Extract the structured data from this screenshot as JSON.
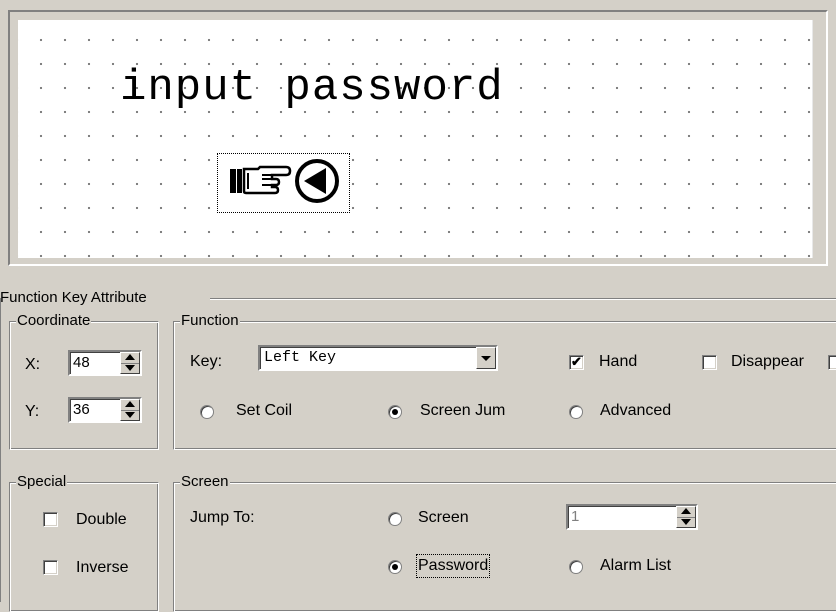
{
  "preview": {
    "title": "input password",
    "key_icons": [
      "pointing-hand-icon",
      "left-arrow-circle-icon"
    ]
  },
  "function_key_attribute": {
    "legend": "Function Key Attribute",
    "coordinate": {
      "legend": "Coordinate",
      "x_label": "X:",
      "x_value": "48",
      "y_label": "Y:",
      "y_value": "36"
    },
    "function": {
      "legend": "Function",
      "key_label": "Key:",
      "key_value": "Left Key",
      "hand_label": "Hand",
      "hand_checked": true,
      "disappear_label": "Disappear",
      "disappear_checked": false,
      "options": [
        {
          "label": "Set Coil",
          "selected": false
        },
        {
          "label": "Screen Jum",
          "selected": true
        },
        {
          "label": "Advanced",
          "selected": false
        }
      ]
    },
    "special": {
      "legend": "Special",
      "double_label": "Double",
      "double_checked": false,
      "inverse_label": "Inverse",
      "inverse_checked": false
    },
    "screen": {
      "legend": "Screen",
      "jump_to_label": "Jump To:",
      "screen_label": "Screen",
      "screen_selected": false,
      "screen_number": "1",
      "password_label": "Password",
      "password_selected": true,
      "alarm_list_label": "Alarm List",
      "alarm_list_selected": false
    }
  }
}
